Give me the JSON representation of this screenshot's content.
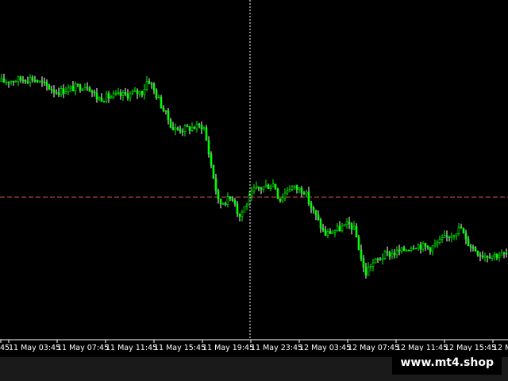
{
  "chart_data": {
    "type": "candlestick",
    "title": "",
    "xlabel": "",
    "ylabel": "",
    "ylim": [
      0,
      100
    ],
    "grid": false,
    "x_tick_labels": [
      "11 May 03:45",
      "11 May 07:45",
      "11 May 11:45",
      "11 May 15:45",
      "11 May 19:45",
      "11 May 23:45",
      "12 May 03:45",
      "12 May 07:45",
      "12 May 11:45",
      "12 May 15:45",
      "12 M"
    ],
    "leading_tick_fragment": "45",
    "reference_level": 42,
    "crosshair_label": "11 May 23:45",
    "price_path": [
      {
        "t": 0,
        "v": 76
      },
      {
        "t": 0.06,
        "v": 77
      },
      {
        "t": 0.11,
        "v": 73
      },
      {
        "t": 0.17,
        "v": 75
      },
      {
        "t": 0.19,
        "v": 71
      },
      {
        "t": 0.24,
        "v": 72
      },
      {
        "t": 0.28,
        "v": 73
      },
      {
        "t": 0.29,
        "v": 77
      },
      {
        "t": 0.34,
        "v": 62
      },
      {
        "t": 0.36,
        "v": 62
      },
      {
        "t": 0.4,
        "v": 63
      },
      {
        "t": 0.43,
        "v": 40
      },
      {
        "t": 0.46,
        "v": 42
      },
      {
        "t": 0.47,
        "v": 36
      },
      {
        "t": 0.5,
        "v": 44
      },
      {
        "t": 0.54,
        "v": 46
      },
      {
        "t": 0.55,
        "v": 41
      },
      {
        "t": 0.57,
        "v": 45
      },
      {
        "t": 0.6,
        "v": 44
      },
      {
        "t": 0.61,
        "v": 40
      },
      {
        "t": 0.64,
        "v": 31
      },
      {
        "t": 0.69,
        "v": 34
      },
      {
        "t": 0.7,
        "v": 32
      },
      {
        "t": 0.72,
        "v": 19
      },
      {
        "t": 0.73,
        "v": 22
      },
      {
        "t": 0.76,
        "v": 25
      },
      {
        "t": 0.79,
        "v": 26
      },
      {
        "t": 0.82,
        "v": 28
      },
      {
        "t": 0.85,
        "v": 27
      },
      {
        "t": 0.88,
        "v": 30
      },
      {
        "t": 0.91,
        "v": 33
      },
      {
        "t": 0.92,
        "v": 29
      },
      {
        "t": 0.95,
        "v": 25
      },
      {
        "t": 1.0,
        "v": 25
      }
    ]
  },
  "brand": {
    "watermark": "www.mt4.shop"
  },
  "colors": {
    "background": "#000000",
    "bull": "#00ff00",
    "bear": "#ffffff",
    "reference_line": "#b04545",
    "crosshair": "#ffffff",
    "axis_text": "#ffffff"
  }
}
